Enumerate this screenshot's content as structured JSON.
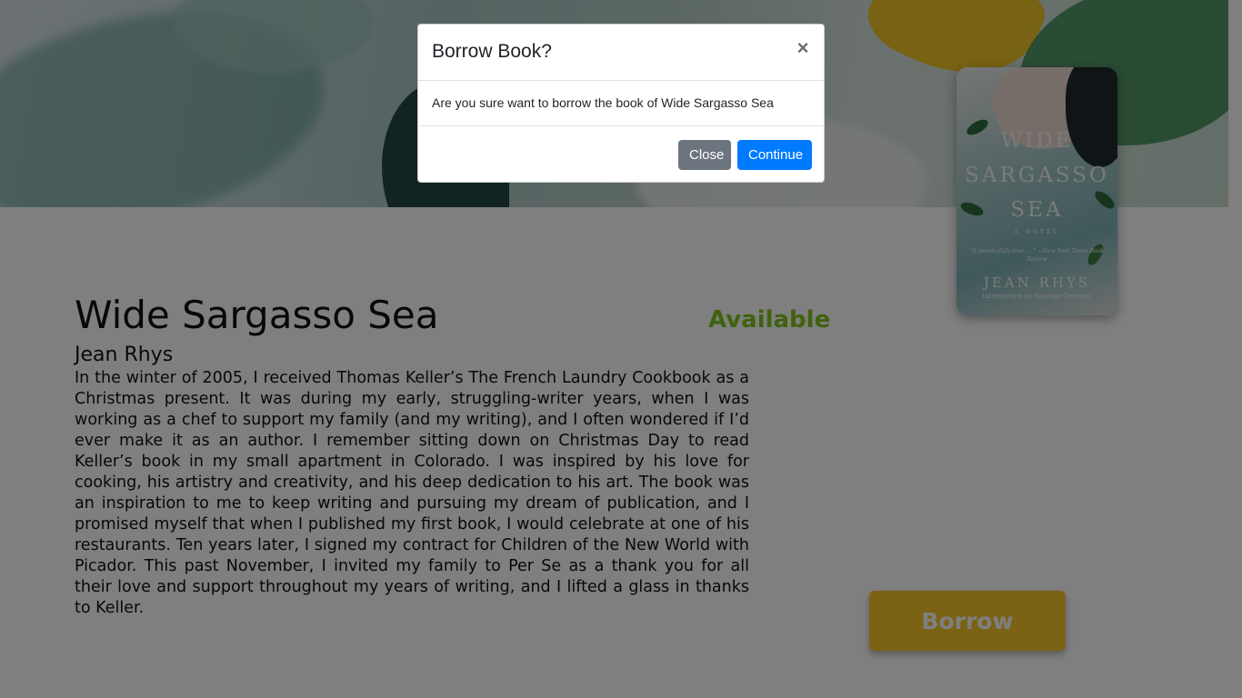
{
  "book": {
    "title": "Wide Sargasso Sea",
    "author": "Jean Rhys",
    "status": "Available",
    "status_color": "#80c41c",
    "description": "In the winter of 2005, I received Thomas Keller’s The French Laundry Cookbook as a Christmas present. It was during my early, struggling-writer years, when I was working as a chef to support my family (and my writing), and I often wondered if I’d ever make it as an author. I remember sitting down on Christmas Day to read Keller’s book in my small apartment in Colorado. I was inspired by his love for cooking, his artistry and creativity, and his deep dedication to his art. The book was an inspiration to me to keep writing and pursuing my dream of publication, and I promised myself that when I published my first book, I would celebrate at one of his restaurants. Ten years later, I signed my contract for Children of the New World with Picador. This past November, I invited my family to Per Se as a thank you for all their love and support throughout my years of writing, and I lifted a glass in thanks to Keller.",
    "cover": {
      "title_line1": "WIDE",
      "title_line2": "SARGASSO",
      "title_line3": "SEA",
      "subtitle": "A NOVEL",
      "quote": "“A wonderfully true ... ” —New York Times Book Review",
      "author": "JEAN RHYS",
      "intro": "Introduction by Edwidge Danticat"
    }
  },
  "actions": {
    "borrow_label": "Borrow",
    "borrow_color": "#f6c52b"
  },
  "modal": {
    "title": "Borrow Book?",
    "close_icon": "×",
    "message": "Are you sure want to borrow the book of Wide Sargasso Sea",
    "close_label": "Close",
    "continue_label": "Continue",
    "close_color": "#6c757d",
    "continue_color": "#007bff"
  }
}
